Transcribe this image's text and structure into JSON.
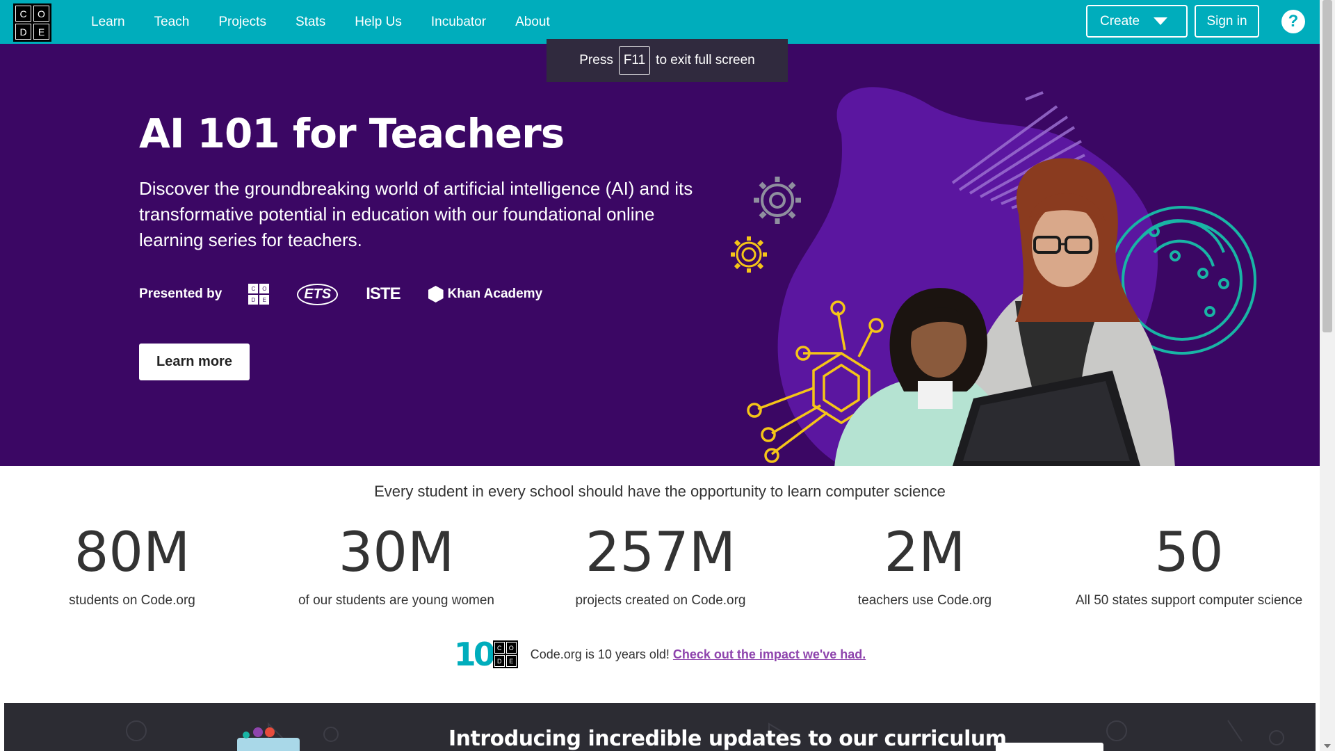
{
  "nav": {
    "logo_letters": [
      "C",
      "O",
      "D",
      "E"
    ],
    "links": [
      "Learn",
      "Teach",
      "Projects",
      "Stats",
      "Help Us",
      "Incubator",
      "About"
    ],
    "create_label": "Create",
    "signin_label": "Sign in",
    "help_label": "?"
  },
  "fullscreen_notice": {
    "before": "Press",
    "key": "F11",
    "after": "to exit full screen"
  },
  "hero": {
    "title": "AI 101 for Teachers",
    "text": "Discover the groundbreaking world of artificial intelligence (AI) and its transformative potential in education with our foundational online learning series for teachers.",
    "presented_by": "Presented by",
    "partners": {
      "codeorg_letters": [
        "C",
        "O",
        "D",
        "E"
      ],
      "ets": "ETS",
      "iste": "ISTE",
      "khan": "Khan Academy"
    },
    "learn_more": "Learn more"
  },
  "tagline": "Every student in every school should have the opportunity to learn computer science",
  "stats": [
    {
      "value": "80M",
      "label": "students on Code.org"
    },
    {
      "value": "30M",
      "label": "of our students are young women"
    },
    {
      "value": "257M",
      "label": "projects created on Code.org"
    },
    {
      "value": "2M",
      "label": "teachers use Code.org"
    },
    {
      "value": "50",
      "label": "All 50 states support computer science"
    }
  ],
  "anniversary": {
    "logo_ten": "10",
    "logo_letters": [
      "C",
      "O",
      "D",
      "E"
    ],
    "text": "Code.org is 10 years old!",
    "link": "Check out the impact we've had."
  },
  "banner": {
    "title": "Introducing incredible updates to our curriculum"
  },
  "colors": {
    "nav_bg": "#00adbc",
    "hero_bg": "#3b0764",
    "accent_purple": "#8e44ad",
    "teal_accent": "#19b5a5",
    "gear_yellow": "#f5c518",
    "banner_bg": "#2c2c33"
  }
}
